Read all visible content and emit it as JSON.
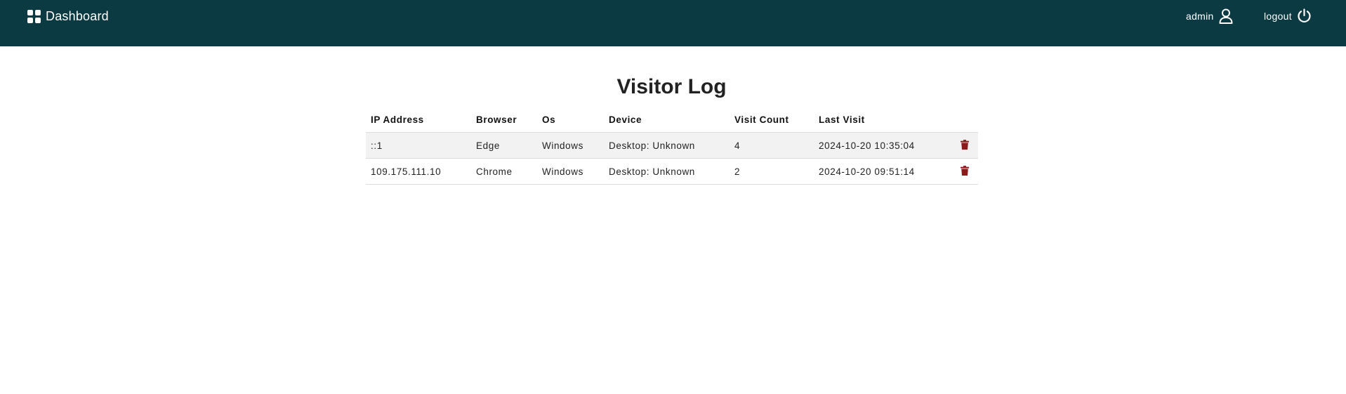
{
  "header": {
    "brand_label": "Dashboard",
    "brand_icon": "grid-icon",
    "user_label": "admin",
    "user_icon": "user-icon",
    "logout_label": "logout",
    "logout_icon": "power-icon",
    "background_color": "#0b3a42"
  },
  "page": {
    "title": "Visitor Log"
  },
  "table": {
    "columns": [
      "IP Address",
      "Browser",
      "Os",
      "Device",
      "Visit Count",
      "Last Visit"
    ],
    "rows": [
      {
        "ip": "::1",
        "browser": "Edge",
        "os": "Windows",
        "device": "Desktop: Unknown",
        "visit_count": "4",
        "last_visit": "2024-10-20 10:35:04"
      },
      {
        "ip": "109.175.111.10",
        "browser": "Chrome",
        "os": "Windows",
        "device": "Desktop: Unknown",
        "visit_count": "2",
        "last_visit": "2024-10-20 09:51:14"
      }
    ],
    "delete_icon": "trash-icon",
    "delete_color": "#8b1a1a"
  }
}
